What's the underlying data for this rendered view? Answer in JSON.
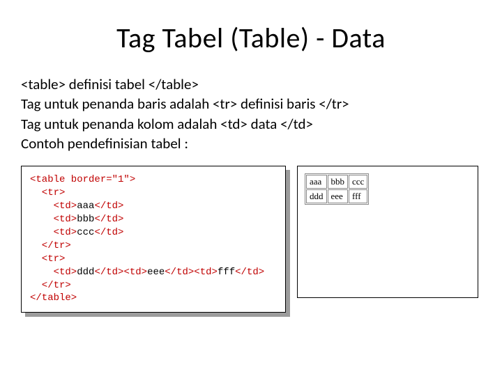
{
  "title": "Tag Tabel (Table) - Data",
  "para": {
    "l1": "<table> definisi tabel </table>",
    "l2": "Tag untuk penanda baris adalah <tr> definisi baris </tr>",
    "l3": "Tag untuk penanda kolom adalah <td> data </td>",
    "l4": "Contoh pendefinisian tabel :"
  },
  "code": {
    "line1": "<table border=\"1\">",
    "line2": "  <tr>",
    "line3a": "    <td>",
    "line3b": "aaa",
    "line3c": "</td>",
    "line4a": "    <td>",
    "line4b": "bbb",
    "line4c": "</td>",
    "line5a": "    <td>",
    "line5b": "ccc",
    "line5c": "</td>",
    "line6": "  </tr>",
    "line7": "  <tr>",
    "line8a": "    <td>",
    "line8b": "ddd",
    "line8c": "</td><td>",
    "line8d": "eee",
    "line8e": "</td><td>",
    "line8f": "fff",
    "line8g": "</td>",
    "line9": "  </tr>",
    "line10": "</table>"
  },
  "render": {
    "r1c1": "aaa",
    "r1c2": "bbb",
    "r1c3": "ccc",
    "r2c1": "ddd",
    "r2c2": "eee",
    "r2c3": "fff"
  }
}
